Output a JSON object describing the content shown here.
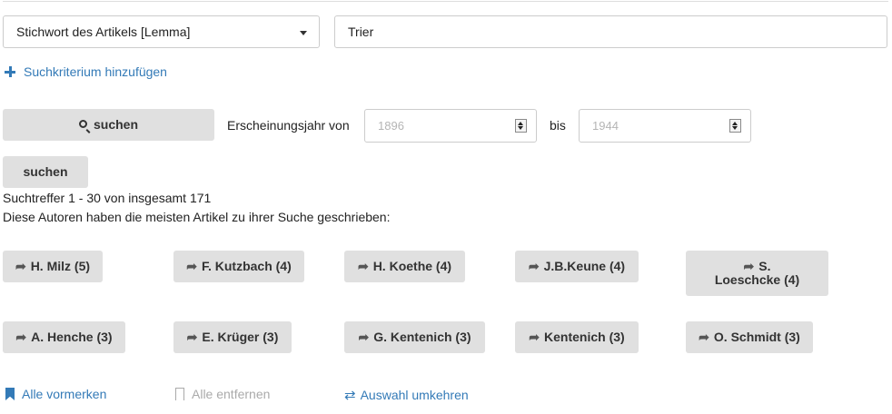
{
  "search": {
    "field_select": "Stichwort des Artikels [Lemma]",
    "query_value": "Trier",
    "add_criterion": "Suchkriterium hinzufügen",
    "search_button": "suchen",
    "search_button_2": "suchen",
    "year_from_label": "Erscheinungsjahr von",
    "year_from_placeholder": "1896",
    "year_to_label": "bis",
    "year_to_placeholder": "1944"
  },
  "results": {
    "count_text": "Suchtreffer 1 - 30 von insgesamt 171",
    "authors_heading": "Diese Autoren haben die meisten Artikel zu ihrer Suche geschrieben:",
    "authors": [
      {
        "label": "H. Milz (5)"
      },
      {
        "label": "F. Kutzbach (4)"
      },
      {
        "label": "H. Koethe (4)"
      },
      {
        "label": "J.B.Keune (4)"
      },
      {
        "label": "S. Loeschcke (4)"
      },
      {
        "label": "A. Henche (3)"
      },
      {
        "label": "E. Krüger (3)"
      },
      {
        "label": "G. Kentenich (3)"
      },
      {
        "label": "Kentenich (3)"
      },
      {
        "label": "O. Schmidt (3)"
      }
    ]
  },
  "actions": {
    "mark_all": "Alle vormerken",
    "remove_all": "Alle entfernen",
    "invert": "Auswahl umkehren"
  },
  "icons": {
    "add": "plus-icon",
    "search": "magnifier-icon",
    "author": "share-arrow-icon",
    "mark": "bookmark-icon",
    "invert": "swap-arrows-icon"
  },
  "colors": {
    "link": "#337ab7",
    "button_bg": "#e0e0e0",
    "disabled": "#aaaaaa"
  }
}
